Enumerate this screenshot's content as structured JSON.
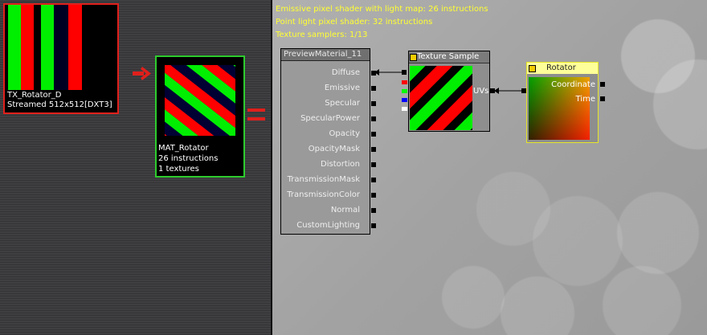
{
  "stats": {
    "line1": "Emissive pixel shader with light map: 26 instructions",
    "line2": "Point light pixel shader: 32 instructions",
    "line3": "Texture samplers: 1/13"
  },
  "texture_card": {
    "name": "TX_Rotator_D",
    "info": "Streamed 512x512[DXT3]"
  },
  "material_card": {
    "name": "MAT_Rotator",
    "instructions": "26 instructions",
    "textures": "1 textures"
  },
  "preview_node": {
    "title": "PreviewMaterial_11",
    "pins": [
      "Diffuse",
      "Emissive",
      "Specular",
      "SpecularPower",
      "Opacity",
      "OpacityMask",
      "Distortion",
      "TransmissionMask",
      "TransmissionColor",
      "Normal",
      "CustomLighting"
    ]
  },
  "texture_sample_node": {
    "title": "Texture Sample",
    "input_pin": "UVs",
    "channel_colors": [
      "#ff0000",
      "#00ff00",
      "#0000ff",
      "#ffffff"
    ]
  },
  "rotator_node": {
    "title": "Rotator",
    "pins": [
      "Coordinate",
      "Time"
    ]
  },
  "colors": {
    "stats_text": "#ffff33",
    "texture_border": "#e0201c",
    "material_border": "#2ecc2e",
    "arrow": "#e0201c",
    "rotator_border": "#e6e629"
  }
}
